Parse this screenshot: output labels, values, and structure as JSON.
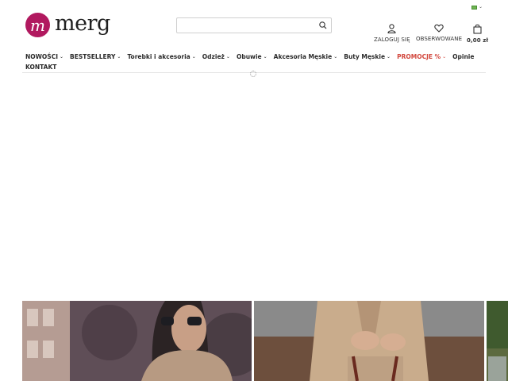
{
  "header": {
    "language_icon": "flag-icon",
    "logo_text": "merg",
    "logo_mark": "m",
    "search": {
      "placeholder": "",
      "icon": "search-icon"
    },
    "actions": [
      {
        "label": "ZALOGUJ SIĘ",
        "icon": "user-icon"
      },
      {
        "label": "OBSERWOWANE",
        "icon": "heart-icon"
      },
      {
        "label": "0,00 zł",
        "icon": "bag-icon"
      }
    ]
  },
  "nav": {
    "items": [
      {
        "label": "NOWOŚCI",
        "has_dropdown": true
      },
      {
        "label": "BESTSELLERY",
        "has_dropdown": true
      },
      {
        "label": "Torebki i akcesoria",
        "has_dropdown": true
      },
      {
        "label": "Odzież",
        "has_dropdown": true
      },
      {
        "label": "Obuwie",
        "has_dropdown": true
      },
      {
        "label": "Akcesoria Męskie",
        "has_dropdown": true
      },
      {
        "label": "Buty Męskie",
        "has_dropdown": true
      },
      {
        "label": "PROMOCJE %",
        "has_dropdown": true
      },
      {
        "label": "Opinie",
        "has_dropdown": false
      },
      {
        "label": "KONTAKT",
        "has_dropdown": false
      }
    ]
  },
  "colors": {
    "brand": "#b1195f",
    "promo": "#d2463c",
    "text": "#2a2a2a"
  },
  "banners": [
    {
      "name": "banner-woman-sunglasses"
    },
    {
      "name": "banner-beige-suit-handbag"
    },
    {
      "name": "banner-partial-right"
    }
  ]
}
